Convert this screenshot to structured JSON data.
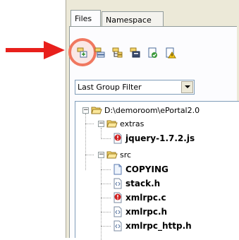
{
  "tabs": [
    {
      "label": "Files"
    },
    {
      "label": "Namespace"
    }
  ],
  "toolbar": {
    "buttons": [
      {
        "icon": "add-project-icon"
      },
      {
        "icon": "add-group-icon"
      },
      {
        "icon": "tree-view-icon"
      },
      {
        "icon": "folder-settings-icon"
      },
      {
        "icon": "check-file-icon"
      },
      {
        "icon": "warning-file-icon"
      }
    ]
  },
  "filter": {
    "selected": "Last Group Filter"
  },
  "tree": {
    "root": "D:\\demoroom\\ePortal2.0",
    "extras": "extras",
    "jquery": "jquery-1.7.2.js",
    "src": "src",
    "copying": "COPYING",
    "stack_h": "stack.h",
    "xmlrpc_c": "xmlrpc.c",
    "xmlrpc_h": "xmlrpc.h",
    "xmlrpc_http_h": "xmlrpc_http.h"
  },
  "colors": {
    "arrow": "#e8201c",
    "highlight": "#f07860"
  }
}
